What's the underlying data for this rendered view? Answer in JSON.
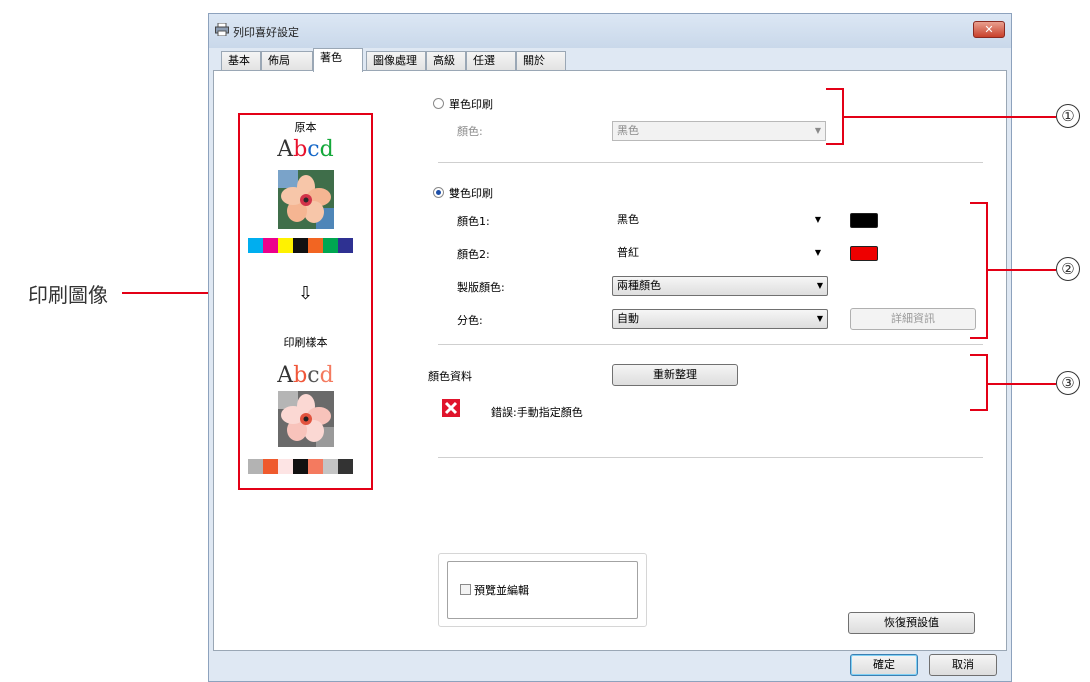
{
  "window": {
    "title": "列印喜好設定",
    "close_label": "✕",
    "tabs": [
      {
        "label": "基本"
      },
      {
        "label": "佈局"
      },
      {
        "label": "著色",
        "active": true
      },
      {
        "label": "圖像處理"
      },
      {
        "label": "高級"
      },
      {
        "label": "任選"
      },
      {
        "label": "關於"
      }
    ]
  },
  "callouts": {
    "print_image_label": "印刷圖像",
    "numbers": [
      "①",
      "②",
      "③"
    ]
  },
  "preview": {
    "original_label": "原本",
    "sample_label": "印刷樣本",
    "abcd_original": [
      "A",
      "b",
      "c",
      "d"
    ],
    "abcd_sample": [
      "A",
      "b",
      "c",
      "d"
    ],
    "arrow": "⇩",
    "original_swatches": [
      "#00aeef",
      "#ec008c",
      "#fff200",
      "#111111",
      "#f26522",
      "#00a651",
      "#2e3192"
    ],
    "sample_swatches": [
      "#b3b3b3",
      "#ef5a2d",
      "#fde4e4",
      "#111111",
      "#f47a5f",
      "#c4c4c4",
      "#333333"
    ]
  },
  "mono": {
    "radio_label": "單色印刷",
    "color_label": "顏色:",
    "color_value": "黑色"
  },
  "dual": {
    "radio_label": "雙色印刷",
    "color1_label": "顏色1:",
    "color1_value": "黑色",
    "color1_chip": "#000000",
    "color2_label": "顏色2:",
    "color2_value": "普紅",
    "color2_chip": "#ee0000",
    "master_label": "製版顏色:",
    "master_value": "兩種顏色",
    "separation_label": "分色:",
    "separation_value": "自動",
    "details_button": "詳細資訊"
  },
  "color_data": {
    "label": "顏色資料",
    "refresh_button": "重新整理",
    "error_text": "錯誤:手動指定顏色"
  },
  "preview_edit": {
    "checkbox_label": "預覽並編輯",
    "checked": false
  },
  "buttons": {
    "restore_default": "恢復預設值",
    "ok": "確定",
    "cancel": "取消"
  },
  "colors": {
    "accent_red": "#e30016",
    "error_red": "#e0142c"
  }
}
